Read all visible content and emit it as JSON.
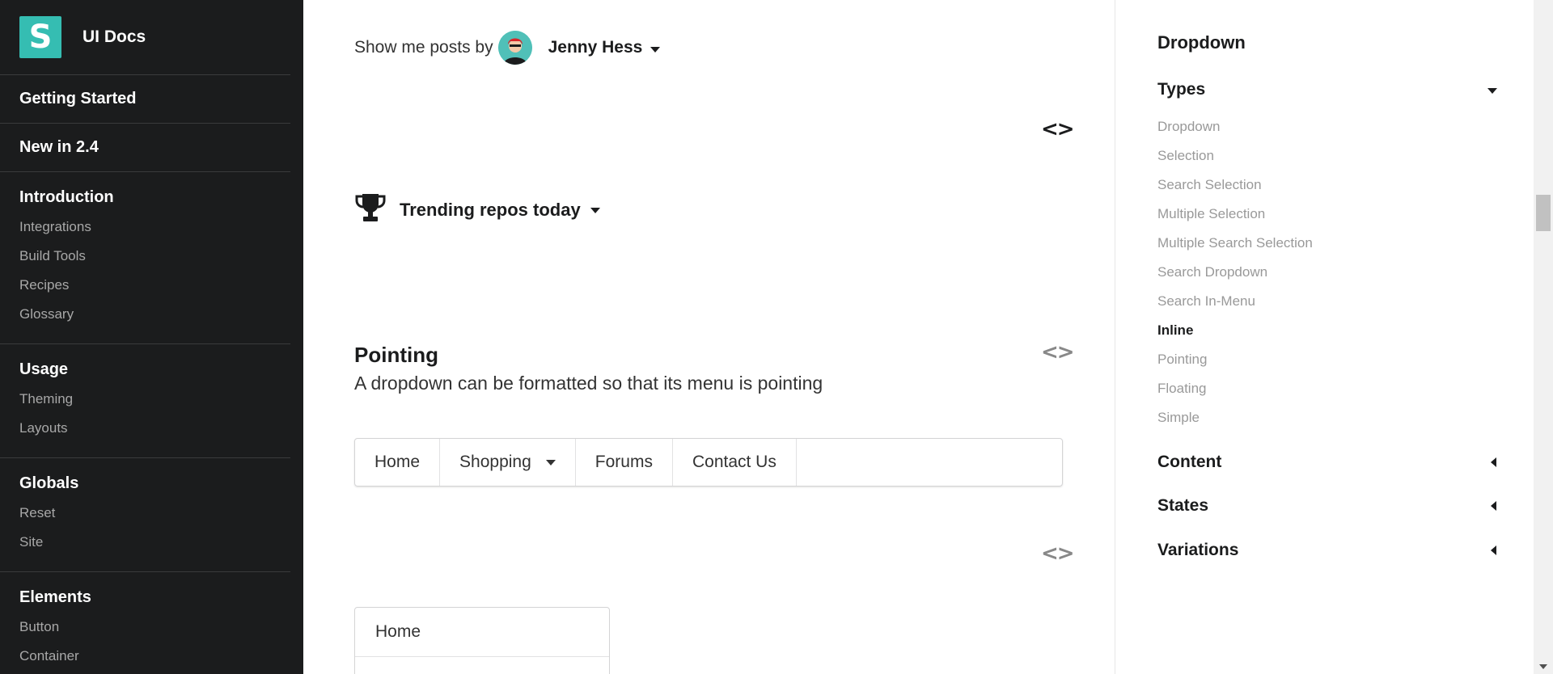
{
  "sidebar": {
    "logo_letter": "S",
    "title": "UI Docs",
    "single_items": [
      "Getting Started",
      "New in 2.4"
    ],
    "groups": [
      {
        "heading": "Introduction",
        "items": [
          "Integrations",
          "Build Tools",
          "Recipes",
          "Glossary"
        ]
      },
      {
        "heading": "Usage",
        "items": [
          "Theming",
          "Layouts"
        ]
      },
      {
        "heading": "Globals",
        "items": [
          "Reset",
          "Site"
        ]
      },
      {
        "heading": "Elements",
        "items": [
          "Button",
          "Container"
        ]
      }
    ]
  },
  "main": {
    "posts_label": "Show me posts by",
    "user_name": "Jenny Hess",
    "trending_label": "Trending repos today",
    "section_title": "Pointing",
    "section_desc": "A dropdown can be formatted so that its menu is pointing",
    "menu_items": [
      "Home",
      "Shopping",
      "Forums",
      "Contact Us"
    ],
    "vertical_menu_items": [
      "Home",
      ""
    ],
    "code_icon": "<>"
  },
  "toc": {
    "title": "Dropdown",
    "categories": {
      "types": "Types",
      "content": "Content",
      "states": "States",
      "variations": "Variations"
    },
    "type_links": [
      "Dropdown",
      "Selection",
      "Search Selection",
      "Multiple Selection",
      "Multiple Search Selection",
      "Search Dropdown",
      "Search In-Menu",
      "Inline",
      "Pointing",
      "Floating",
      "Simple"
    ],
    "active_link": "Inline"
  },
  "colors": {
    "sidebar_bg": "#1b1c1d",
    "logo_teal": "#35bdb2",
    "muted_text": "#999999"
  }
}
